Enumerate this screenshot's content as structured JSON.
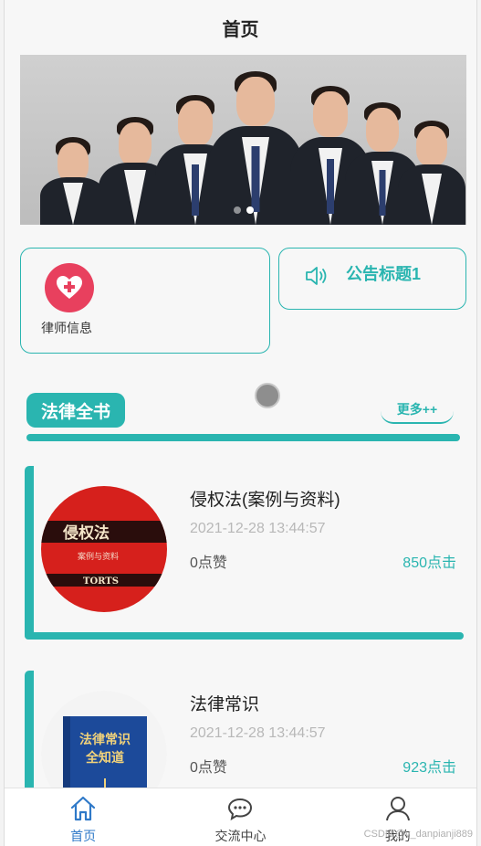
{
  "header": {
    "title": "首页"
  },
  "banner": {
    "slides": 2,
    "active_slide": 1
  },
  "lawyer_card": {
    "label": "律师信息",
    "icon": "heart-plus-icon"
  },
  "notice_card": {
    "label": "公告标题1",
    "icon": "speaker-icon"
  },
  "section": {
    "title": "法律全书",
    "more_label": "更多++"
  },
  "books": [
    {
      "title": "侵权法(案例与资料)",
      "date": "2021-12-28 13:44:57",
      "likes": "0点赞",
      "clicks": "850点击",
      "cover_title": "侵权法",
      "cover_subtitle": "案例与资料",
      "cover_en": "TORTS"
    },
    {
      "title": "法律常识",
      "date": "2021-12-28 13:44:57",
      "likes": "0点赞",
      "clicks": "923点击",
      "cover_title": "法律常识全知道"
    }
  ],
  "tabbar": {
    "items": [
      {
        "label": "首页",
        "icon": "home-icon",
        "active": true
      },
      {
        "label": "交流中心",
        "icon": "chat-icon",
        "active": false
      },
      {
        "label": "我的",
        "icon": "user-icon",
        "active": false
      }
    ]
  },
  "watermark": "CSDN @v_danpianji889",
  "colors": {
    "accent": "#2ab5b0",
    "heart": "#e8405e",
    "tab_active": "#2f79c8"
  }
}
